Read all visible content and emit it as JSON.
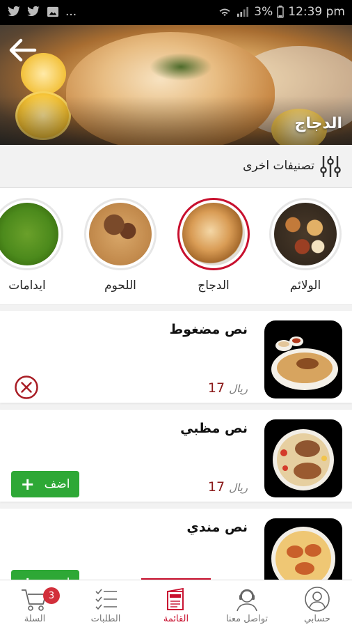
{
  "status_bar": {
    "battery": "3%",
    "time": "12:39 pm",
    "more": "..."
  },
  "header": {
    "title": "الدجاج"
  },
  "subheader": {
    "label": "تصنيفات اخرى"
  },
  "categories": [
    {
      "label": "الولائم",
      "active": false
    },
    {
      "label": "الدجاج",
      "active": true
    },
    {
      "label": "اللحوم",
      "active": false
    },
    {
      "label": "ايدامات",
      "active": false
    }
  ],
  "products": [
    {
      "name": "نص مضغوط",
      "price": "17",
      "currency": "ريال",
      "in_cart": true
    },
    {
      "name": "نص مظبي",
      "price": "17",
      "currency": "ريال",
      "in_cart": false,
      "add_label": "اضف"
    },
    {
      "name": "نص مندي",
      "in_cart": false,
      "add_label": "اضف"
    }
  ],
  "bottom_nav": {
    "account": "حسابي",
    "contact": "تواصل معنا",
    "menu": "القائمة",
    "orders": "الطلبات",
    "cart": "السلة",
    "cart_count": "3"
  },
  "colors": {
    "accent": "#c8102e",
    "add_button": "#2ea836",
    "price": "#8b1a1a"
  }
}
